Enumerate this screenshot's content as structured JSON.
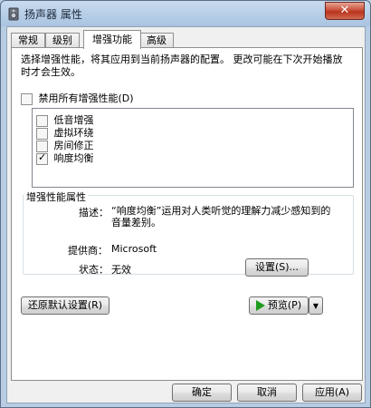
{
  "window": {
    "title": "扬声器 属性"
  },
  "tabs": [
    {
      "label": "常规"
    },
    {
      "label": "级别"
    },
    {
      "label": "增强功能"
    },
    {
      "label": "高级"
    }
  ],
  "description": "选择增强性能，将其应用到当前扬声器的配置。  更改可能在下次开始播放时才会生效。",
  "disable_all": {
    "label": "禁用所有增强性能(D)",
    "checked": false
  },
  "enhancements": [
    {
      "label": "低音增强",
      "checked": false
    },
    {
      "label": "虚拟环绕",
      "checked": false
    },
    {
      "label": "房间修正",
      "checked": false
    },
    {
      "label": "响度均衡",
      "checked": true
    }
  ],
  "properties": {
    "group_title": "增强性能属性",
    "desc_label": "描述：",
    "desc_text": "“响度均衡”运用对人类听觉的理解力减少感知到的音量差别。",
    "provider_label": "提供商：",
    "provider_value": "Microsoft",
    "status_label": "状态：",
    "status_value": "无效",
    "settings_button": "设置(S)..."
  },
  "restore_defaults_button": "还原默认设置(R)",
  "preview_button": "预览(P)",
  "footer": {
    "ok": "确定",
    "cancel": "取消",
    "apply": "应用(A)"
  }
}
